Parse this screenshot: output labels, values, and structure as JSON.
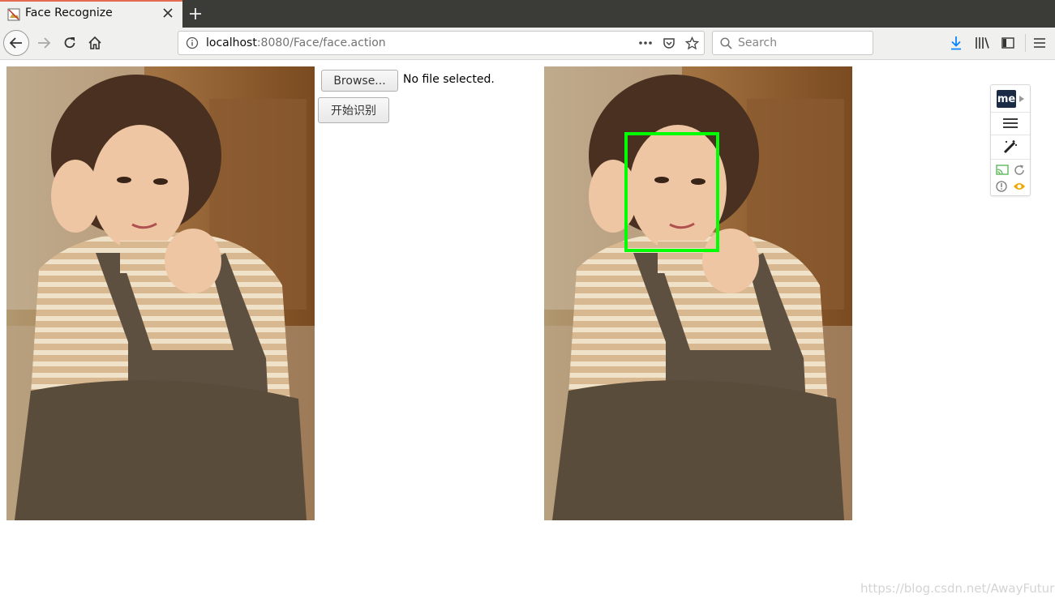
{
  "browser": {
    "tab_title": "Face Recognize",
    "url_host": "localhost",
    "url_rest": ":8080/Face/face.action",
    "search_placeholder": "Search"
  },
  "page": {
    "browse_label": "Browse...",
    "file_status": "No file selected.",
    "start_label": "开始识别",
    "watermark": "https://blog.csdn.net/AwayFuture",
    "extension_logo": "me"
  },
  "colors": {
    "face_box": "#00ff00",
    "tab_accent": "#e66a4f",
    "download_icon": "#0a84ff"
  },
  "icons": [
    "back-arrow-icon",
    "forward-arrow-icon",
    "reload-icon",
    "home-icon",
    "info-icon",
    "more-icon",
    "pocket-icon",
    "bookmark-star-icon",
    "search-icon",
    "download-icon",
    "library-icon",
    "sidebar-icon",
    "menu-icon",
    "close-icon",
    "plus-icon"
  ]
}
